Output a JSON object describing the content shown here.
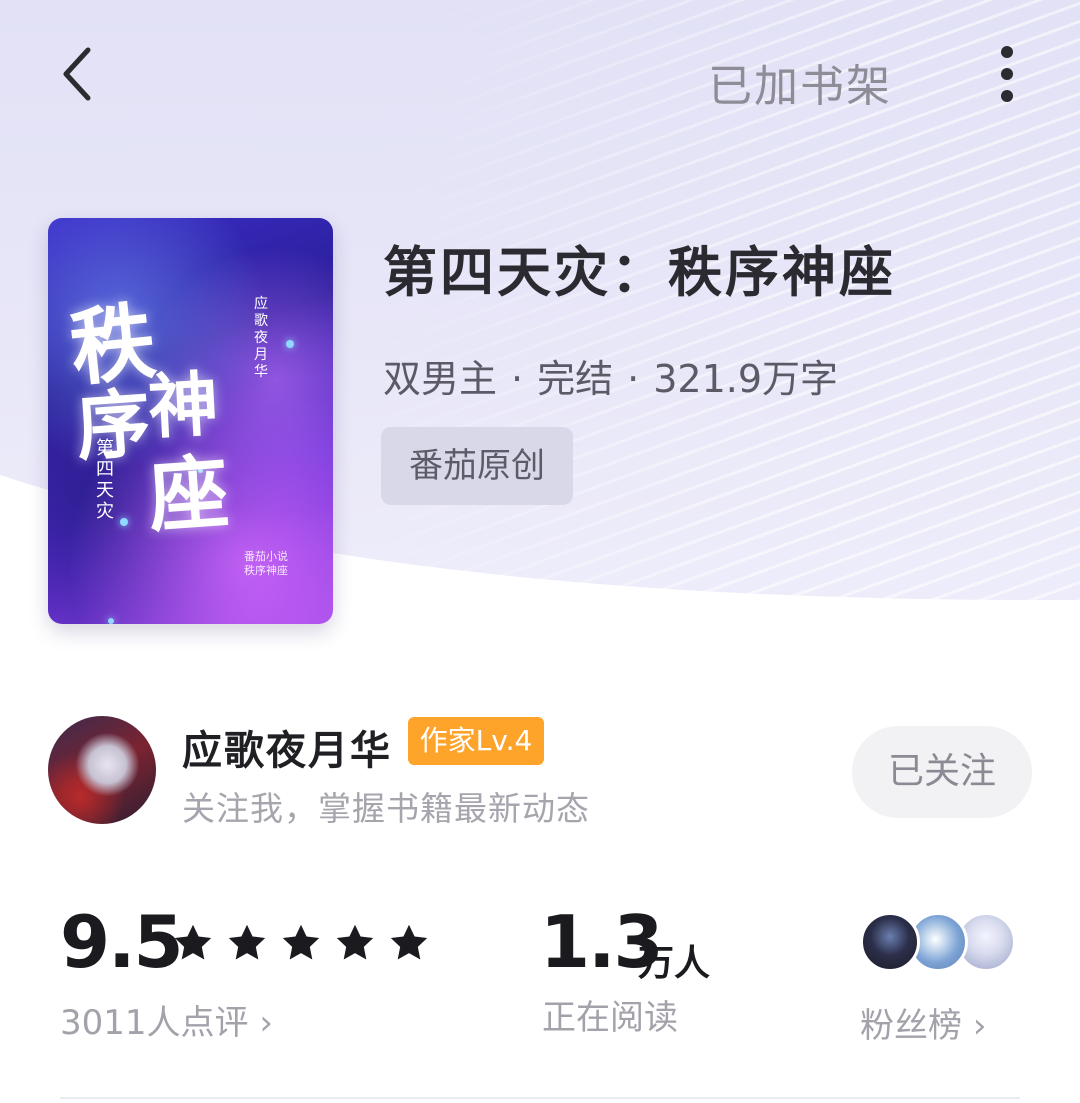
{
  "header": {
    "shelf_label": "已加书架"
  },
  "book": {
    "title": "第四天灾：秩序神座",
    "meta": {
      "genre": "双男主",
      "separator": "·",
      "status": "完结",
      "words": "321.9万字"
    },
    "source_tag": "番茄原创",
    "cover": {
      "title_chars": [
        "秩",
        "序",
        "神",
        "座"
      ],
      "subtitle": "第四天灾",
      "author": "应歌夜月华",
      "stamp_line1": "番茄小说",
      "stamp_line2": "秩序神座"
    }
  },
  "author": {
    "name": "应歌夜月华",
    "badge": "作家Lv.4",
    "subtitle": "关注我，掌握书籍最新动态",
    "follow_label": "已关注"
  },
  "stats": {
    "rating": "9.5",
    "stars": 5,
    "rating_count": "3011人点评",
    "readers_value": "1.3",
    "readers_unit": "万人",
    "readers_label": "正在阅读",
    "fans_label": "粉丝榜",
    "chevron": "›"
  },
  "colors": {
    "badge": "#ffa42b",
    "hero_bg": "#e4e3f7",
    "text_primary": "#1f1f24",
    "text_secondary": "#a3a2ab"
  },
  "icons": {
    "back": "chevron-left-icon",
    "more": "more-vertical-icon",
    "star": "star-icon"
  }
}
